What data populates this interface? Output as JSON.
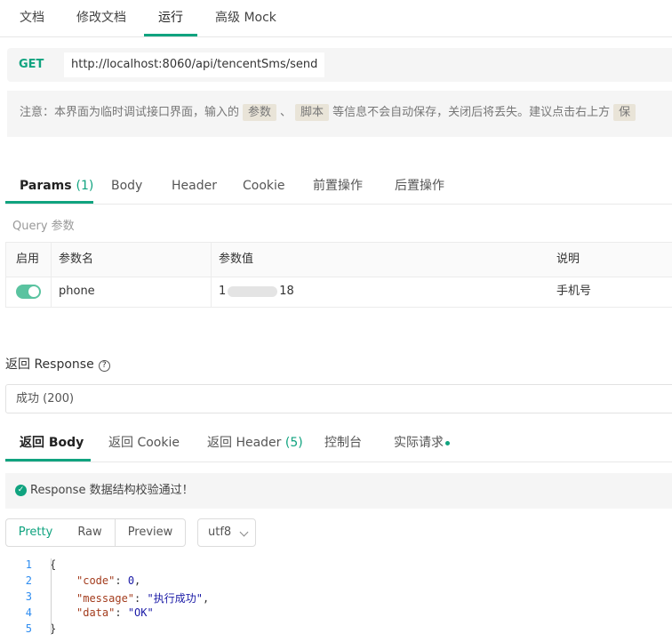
{
  "top_tabs": [
    "文档",
    "修改文档",
    "运行",
    "高级 Mock"
  ],
  "request": {
    "method": "GET",
    "url": "http://localhost:8060/api/tencentSms/send"
  },
  "notice": {
    "prefix": "注意：本界面为临时调试接口界面，输入的",
    "tag1": "参数",
    "sep": "、",
    "tag2": "脚本",
    "suffix": "等信息不会自动保存，关闭后将丢失。建议点击右上方",
    "tag3": "保"
  },
  "param_tabs": {
    "params": "Params",
    "params_count": "(1)",
    "body": "Body",
    "header": "Header",
    "cookie": "Cookie",
    "pre": "前置操作",
    "post": "后置操作"
  },
  "query_label": "Query 参数",
  "params_table": {
    "headers": [
      "启用",
      "参数名",
      "参数值",
      "说明"
    ],
    "rows": [
      {
        "enabled": true,
        "name": "phone",
        "value_start": "1",
        "value_end": "18",
        "desc": "手机号"
      }
    ]
  },
  "response": {
    "title": "返回 Response",
    "status": "成功 (200)",
    "tabs": {
      "body": "返回 Body",
      "cookie": "返回 Cookie",
      "header": "返回 Header",
      "header_count": "(5)",
      "console": "控制台",
      "actual": "实际请求"
    },
    "validation": "Response 数据结构校验通过！",
    "formats": [
      "Pretty",
      "Raw",
      "Preview"
    ],
    "encoding": "utf8",
    "code": {
      "line_numbers": [
        "1",
        "2",
        "3",
        "4",
        "5"
      ],
      "open": "{",
      "code_key": "\"code\"",
      "code_val": "0",
      "message_key": "\"message\"",
      "message_val": "\"执行成功\"",
      "data_key": "\"data\"",
      "data_val": "\"OK\"",
      "close": "}"
    }
  },
  "colors": {
    "accent": "#10a37f"
  }
}
